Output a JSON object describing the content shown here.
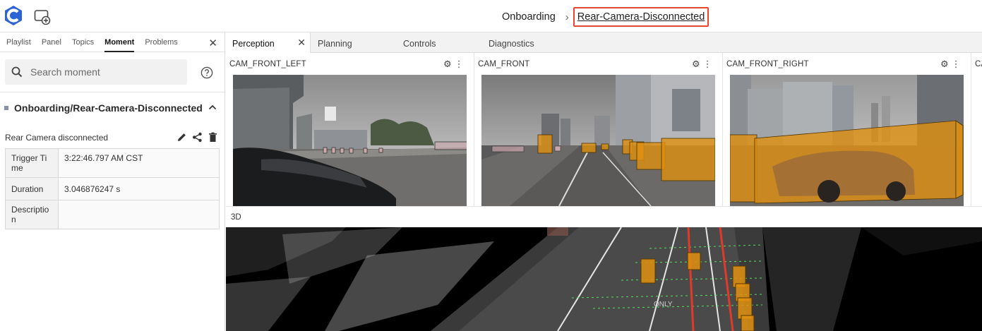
{
  "header": {
    "breadcrumb": [
      "Onboarding",
      "Rear-Camera-Disconnected"
    ],
    "separator": "›"
  },
  "left_panel": {
    "tabs": [
      "Playlist",
      "Panel",
      "Topics",
      "Moment",
      "Problems"
    ],
    "active_tab": "Moment",
    "search": {
      "placeholder": "Search moment",
      "value": ""
    },
    "group_title": "Onboarding/Rear-Camera-Disconnected",
    "moment_name": "Rear Camera disconnected",
    "properties": [
      {
        "key": "Trigger Ti me",
        "value": "3:22:46.797 AM CST"
      },
      {
        "key": "Duration",
        "value": "3.046876247 s"
      },
      {
        "key": "Descriptio n",
        "value": ""
      }
    ]
  },
  "workspace": {
    "tabs": [
      "Perception",
      "Planning",
      "Controls",
      "Diagnostics"
    ],
    "active_tab": "Perception",
    "cameras": [
      "CAM_FRONT_LEFT",
      "CAM_FRONT",
      "CAM_FRONT_RIGHT",
      "CA"
    ],
    "pane_3d_title": "3D",
    "road_marking": "ONLY"
  },
  "colors": {
    "highlight_border": "#e5472d",
    "bounding_box": "#e0900f",
    "logo": "#2e63d6"
  },
  "icons": [
    "logo-icon",
    "new-window-icon",
    "close-icon",
    "search-icon",
    "help-icon",
    "chevron-up-icon",
    "edit-icon",
    "share-icon",
    "delete-icon",
    "gear-icon",
    "more-vert-icon"
  ]
}
